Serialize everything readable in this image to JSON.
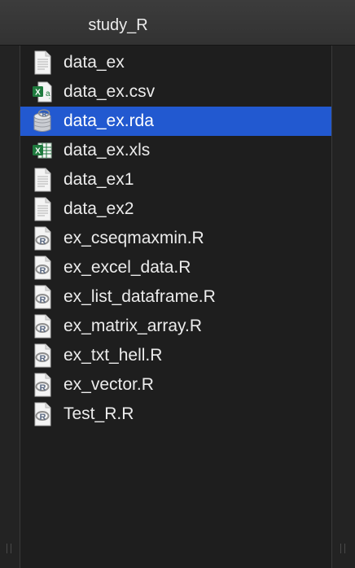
{
  "window": {
    "title": "study_R"
  },
  "files": [
    {
      "name": "data_ex",
      "icon": "text-file-icon",
      "selected": false
    },
    {
      "name": "data_ex.csv",
      "icon": "excel-csv-icon",
      "selected": false
    },
    {
      "name": "data_ex.rda",
      "icon": "rda-data-icon",
      "selected": true
    },
    {
      "name": "data_ex.xls",
      "icon": "excel-xls-icon",
      "selected": false
    },
    {
      "name": "data_ex1",
      "icon": "text-file-icon",
      "selected": false
    },
    {
      "name": "data_ex2",
      "icon": "text-file-icon",
      "selected": false
    },
    {
      "name": "ex_cseqmaxmin.R",
      "icon": "r-script-icon",
      "selected": false
    },
    {
      "name": "ex_excel_data.R",
      "icon": "r-script-icon",
      "selected": false
    },
    {
      "name": "ex_list_dataframe.R",
      "icon": "r-script-icon",
      "selected": false
    },
    {
      "name": "ex_matrix_array.R",
      "icon": "r-script-icon",
      "selected": false
    },
    {
      "name": "ex_txt_hell.R",
      "icon": "r-script-icon",
      "selected": false
    },
    {
      "name": "ex_vector.R",
      "icon": "r-script-icon",
      "selected": false
    },
    {
      "name": "Test_R.R",
      "icon": "r-script-icon",
      "selected": false
    }
  ],
  "colors": {
    "selection": "#2259d0",
    "background": "#1e1e1e",
    "text": "#ececec",
    "excel_green": "#1f7a3e"
  }
}
